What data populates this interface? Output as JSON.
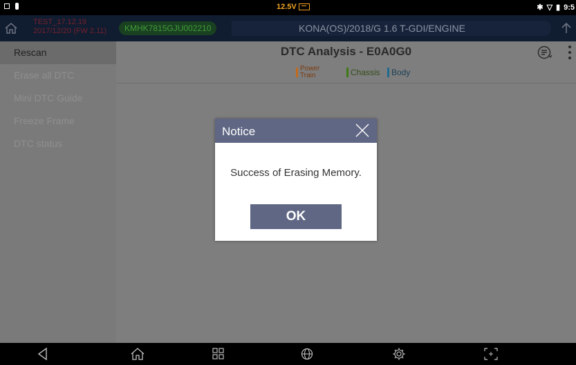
{
  "status_bar": {
    "voltage": "12.5V",
    "time": "9:5"
  },
  "header": {
    "test_line1": "TEST_17.12.19",
    "test_line2": "2017/12/20 (FW 2.11)",
    "vin": "KMHK7815GJU002210",
    "model": "KONA(OS)/2018/G 1.6 T-GDI/ENGINE"
  },
  "sidebar": {
    "items": [
      {
        "label": "Rescan"
      },
      {
        "label": "Erase all DTC"
      },
      {
        "label": "Mini DTC Guide"
      },
      {
        "label": "Freeze Frame"
      },
      {
        "label": "DTC status"
      }
    ]
  },
  "main": {
    "title": "DTC Analysis - E0A0G0",
    "legend": {
      "power_train_1": "Power",
      "power_train_2": "Train",
      "chassis": "Chassis",
      "body": "Body"
    }
  },
  "dialog": {
    "title": "Notice",
    "message": "Success of Erasing Memory.",
    "ok_label": "OK"
  },
  "icons": {
    "home": "home-icon",
    "up": "upload-icon",
    "filter": "list-filter-icon",
    "more": "more-vertical-icon",
    "close": "close-icon",
    "back": "back-icon",
    "grid": "grid-icon",
    "globe": "globe-icon",
    "settings": "gear-icon",
    "capture": "screen-capture-icon"
  },
  "colors": {
    "header_bg": "#101c30",
    "dialog_accent": "#5f6784",
    "voltage": "#f5a623",
    "vin_text": "#4fbb3a",
    "test_text": "#c5262b",
    "power_train": "#c36a1c",
    "chassis": "#3e7a15",
    "body": "#1f6a8f"
  }
}
